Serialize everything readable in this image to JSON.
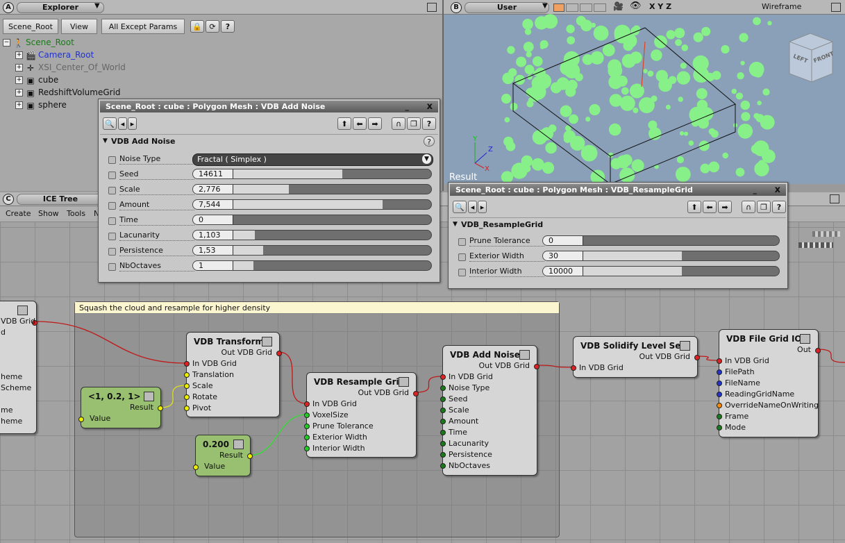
{
  "explorer": {
    "letter": "A",
    "title": "Explorer",
    "toolbar": {
      "scope": "Scene_Root",
      "view": "View",
      "filter": "All Except Params"
    },
    "tree": [
      {
        "label": "Scene_Root",
        "color": "#1a7a1a"
      },
      {
        "label": "Camera_Root",
        "color": "#2233cc"
      },
      {
        "label": "XSI_Center_Of_World",
        "color": "#666666"
      },
      {
        "label": "cube",
        "color": "#111111"
      },
      {
        "label": "RedshiftVolumeGrid",
        "color": "#111111"
      },
      {
        "label": "sphere",
        "color": "#111111"
      }
    ]
  },
  "viewport": {
    "letter": "B",
    "camera": "User",
    "axes": "X Y Z",
    "shading": "Wireframe",
    "label": "Result",
    "cube_faces": [
      "LEFT",
      "FRONT"
    ]
  },
  "icetree": {
    "letter": "C",
    "title": "ICE Tree",
    "menu": [
      "Create",
      "Show",
      "Tools",
      "N"
    ]
  },
  "ppg_noise": {
    "title": "Scene_Root : cube : Polygon Mesh : VDB Add Noise",
    "section": "VDB Add Noise",
    "noise_type_label": "Noise Type",
    "noise_type_value": "Fractal ( Simplex )",
    "params": [
      {
        "label": "Seed",
        "value": "14611",
        "fill": 0.55
      },
      {
        "label": "Scale",
        "value": "2,776",
        "fill": 0.28
      },
      {
        "label": "Amount",
        "value": "7,544",
        "fill": 0.75
      },
      {
        "label": "Time",
        "value": "0",
        "fill": 0
      },
      {
        "label": "Lacunarity",
        "value": "1,103",
        "fill": 0.11
      },
      {
        "label": "Persistence",
        "value": "1,53",
        "fill": 0.15
      },
      {
        "label": "NbOctaves",
        "value": "1",
        "fill": 0.1
      }
    ]
  },
  "ppg_resample": {
    "title": "Scene_Root : cube : Polygon Mesh : VDB_ResampleGrid",
    "section": "VDB_ResampleGrid",
    "params": [
      {
        "label": "Prune Tolerance",
        "value": "0",
        "fill": 0
      },
      {
        "label": "Exterior Width",
        "value": "30",
        "fill": 0.5
      },
      {
        "label": "Interior Width",
        "value": "10000",
        "fill": 0.5
      }
    ]
  },
  "comment": "Squash the cloud and resample for higher density",
  "nodes": {
    "left_partial": {
      "ports": [
        "VDB Grid",
        "d",
        "heme",
        "Scheme",
        "me",
        "heme"
      ]
    },
    "vector": {
      "title": "<1, 0.2, 1>",
      "out": "Result",
      "in": "Value"
    },
    "scalar": {
      "title": "0.200",
      "out": "Result",
      "in": "Value"
    },
    "transform": {
      "title": "VDB Transform",
      "out": "Out VDB Grid",
      "ins": [
        "In VDB Grid",
        "Translation",
        "Scale",
        "Rotate",
        "Pivot"
      ]
    },
    "resample": {
      "title": "VDB Resample Grid",
      "out": "Out VDB Grid",
      "ins": [
        "In VDB Grid",
        "VoxelSize",
        "Prune Tolerance",
        "Exterior Width",
        "Interior Width"
      ]
    },
    "noise": {
      "title": "VDB Add Noise",
      "out": "Out VDB Grid",
      "ins": [
        "In VDB Grid",
        "Noise Type",
        "Seed",
        "Scale",
        "Amount",
        "Time",
        "Lacunarity",
        "Persistence",
        "NbOctaves"
      ]
    },
    "solidify": {
      "title": "VDB Solidify Level Set",
      "out": "Out VDB Grid",
      "ins": [
        "In VDB Grid"
      ]
    },
    "fileio": {
      "title": "VDB File Grid IO",
      "out": "Out",
      "ins": [
        "In VDB Grid",
        "FilePath",
        "FileName",
        "ReadingGridName",
        "OverrideNameOnWriting",
        "Frame",
        "Mode"
      ]
    }
  }
}
